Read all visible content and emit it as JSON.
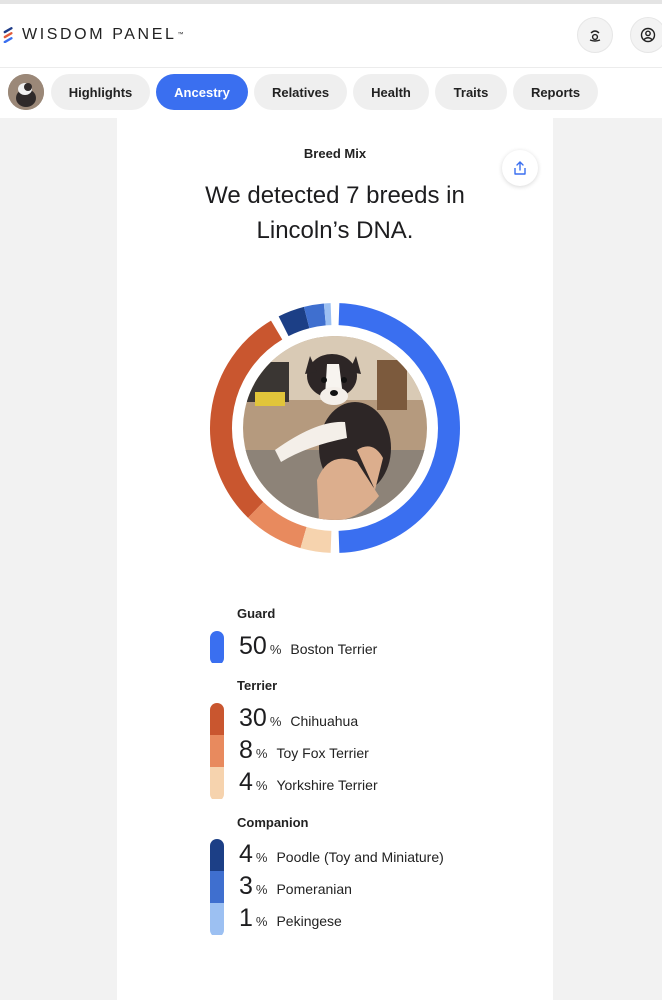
{
  "header": {
    "brand": "WISDOM PANEL",
    "trademark": "™",
    "icons": [
      "dog-paw-icon",
      "user-profile-icon"
    ]
  },
  "nav": {
    "tabs": [
      {
        "label": "Highlights",
        "active": false
      },
      {
        "label": "Ancestry",
        "active": true
      },
      {
        "label": "Relatives",
        "active": false
      },
      {
        "label": "Health",
        "active": false
      },
      {
        "label": "Traits",
        "active": false
      },
      {
        "label": "Reports",
        "active": false
      }
    ],
    "accent": "#3a6ff0"
  },
  "main": {
    "section_title": "Breed Mix",
    "headline": "We detected 7 breeds in Lincoln’s DNA.",
    "share_icon": "share-icon",
    "groups": [
      {
        "name": "Guard",
        "breeds": [
          {
            "percent": "50",
            "symbol": "%",
            "name": "Boston Terrier",
            "color": "#3a6ff0"
          }
        ]
      },
      {
        "name": "Terrier",
        "breeds": [
          {
            "percent": "30",
            "symbol": "%",
            "name": "Chihuahua",
            "color": "#c9562f"
          },
          {
            "percent": "8",
            "symbol": "%",
            "name": "Toy Fox Terrier",
            "color": "#e88a5e"
          },
          {
            "percent": "4",
            "symbol": "%",
            "name": "Yorkshire Terrier",
            "color": "#f6d3ae"
          }
        ]
      },
      {
        "name": "Companion",
        "breeds": [
          {
            "percent": "4",
            "symbol": "%",
            "name": "Poodle (Toy and Miniature)",
            "color": "#1c3f86"
          },
          {
            "percent": "3",
            "symbol": "%",
            "name": "Pomeranian",
            "color": "#3f6fcf"
          },
          {
            "percent": "1",
            "symbol": "%",
            "name": "Pekingese",
            "color": "#9cc0f2"
          }
        ]
      }
    ]
  }
}
